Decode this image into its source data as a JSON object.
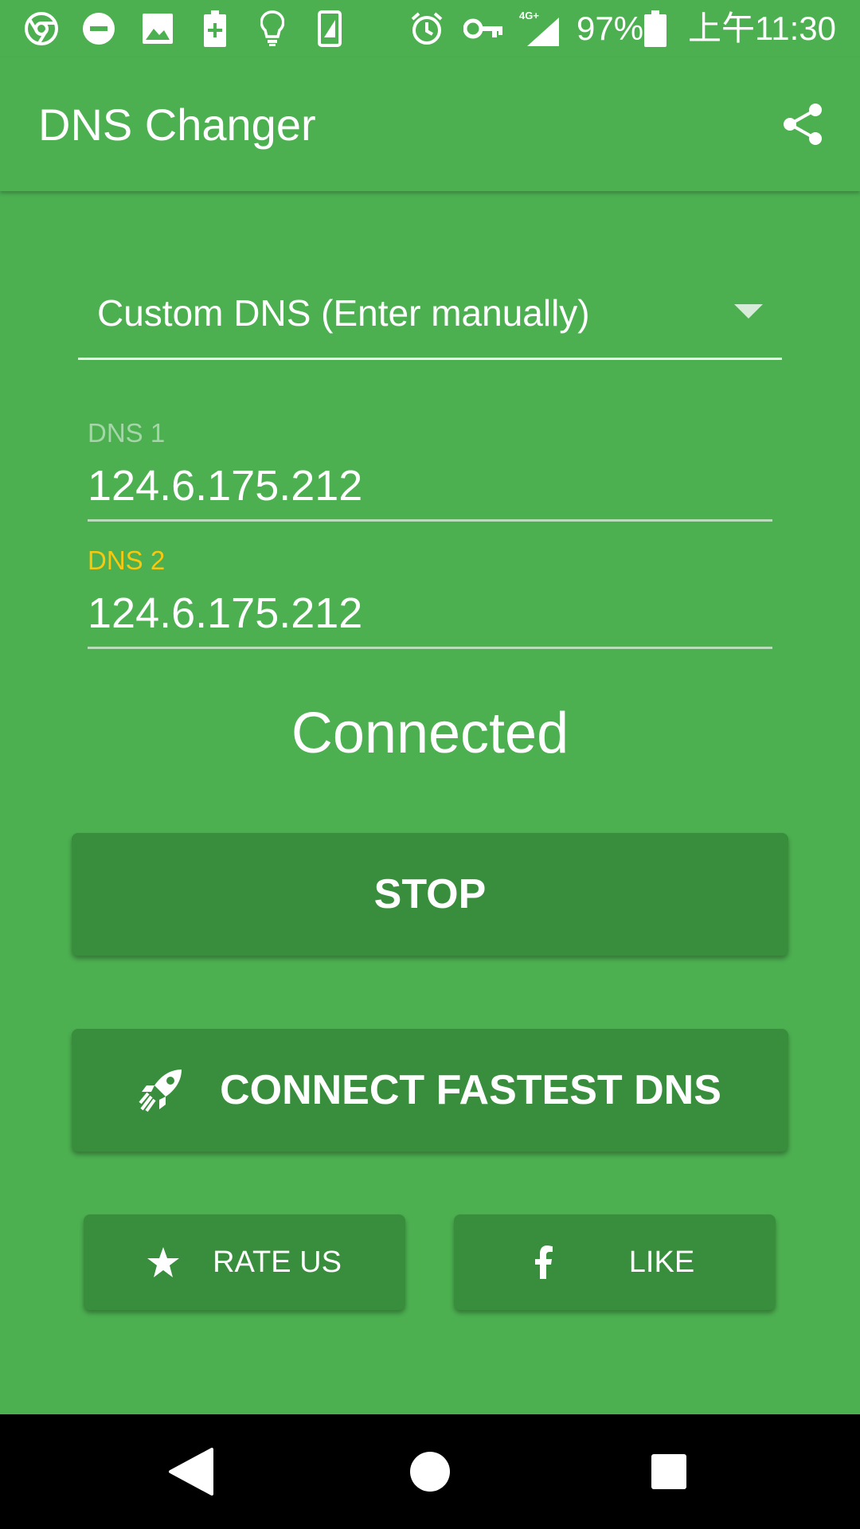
{
  "status_bar": {
    "signal_label": "4G+",
    "battery_percent": "97%",
    "time": "上午11:30",
    "icons": [
      "chrome-icon",
      "dnd-icon",
      "image-icon",
      "battery-saver-icon",
      "bulb-icon",
      "screenshot-icon",
      "alarm-icon",
      "vpn-key-icon",
      "signal-icon",
      "battery-icon"
    ]
  },
  "app_bar": {
    "title": "DNS Changer",
    "share_icon": "share-icon"
  },
  "dns_selector": {
    "selected": "Custom DNS (Enter manually)"
  },
  "dns1": {
    "label": "DNS 1",
    "value": "124.6.175.212",
    "label_color": "#a5d6a7"
  },
  "dns2": {
    "label": "DNS 2",
    "value": "124.6.175.212",
    "label_color": "#f9c80e"
  },
  "connection": {
    "status": "Connected"
  },
  "buttons": {
    "stop": "STOP",
    "connect_fastest": "CONNECT FASTEST DNS",
    "rate_us": "RATE US",
    "like": "LIKE"
  },
  "colors": {
    "background": "#4caf50",
    "button": "#388e3c",
    "nav_bar": "#000000"
  }
}
